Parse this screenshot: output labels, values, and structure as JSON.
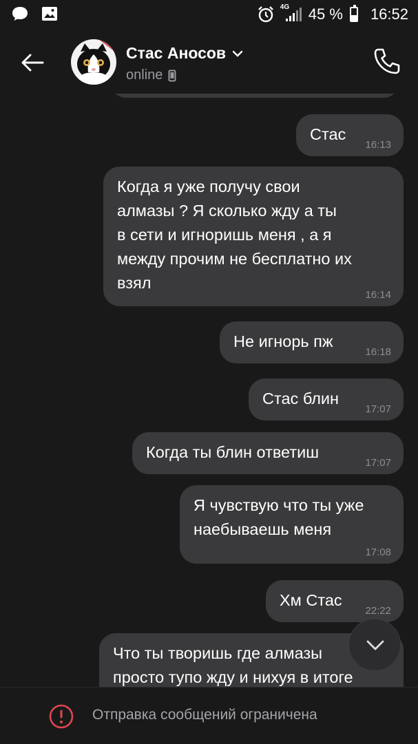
{
  "status_bar": {
    "network": "4G",
    "battery_percent": "45 %",
    "battery_level": 0.45,
    "time": "16:52"
  },
  "header": {
    "contact_name": "Стас Аносов",
    "status": "online"
  },
  "messages": [
    {
      "text": "Стас",
      "time": "16:13"
    },
    {
      "text": "Когда я уже получу свои\nалмазы ? Я сколько жду а ты\nв сети и игноришь меня , а я\nмежду прочим не бесплатно их\nвзял",
      "time": "16:14"
    },
    {
      "text": "Не игнорь пж",
      "time": "16:18"
    },
    {
      "text": "Стас блин",
      "time": "17:07"
    },
    {
      "text": "Когда ты блин ответиш",
      "time": "17:07"
    },
    {
      "text": "Я чувствую что ты уже\nнаебываешь меня",
      "time": "17:08"
    },
    {
      "text": "Хм Стас",
      "time": "22:22"
    },
    {
      "text": "Что ты творишь где алмазы\nпросто тупо жду и нихуя в итоге",
      "time": ""
    }
  ],
  "composer": {
    "restriction_text": "Отправка сообщений ограничена"
  },
  "colors": {
    "background": "#19191a",
    "bubble": "#3a3a3c",
    "warning": "#e0464e"
  }
}
